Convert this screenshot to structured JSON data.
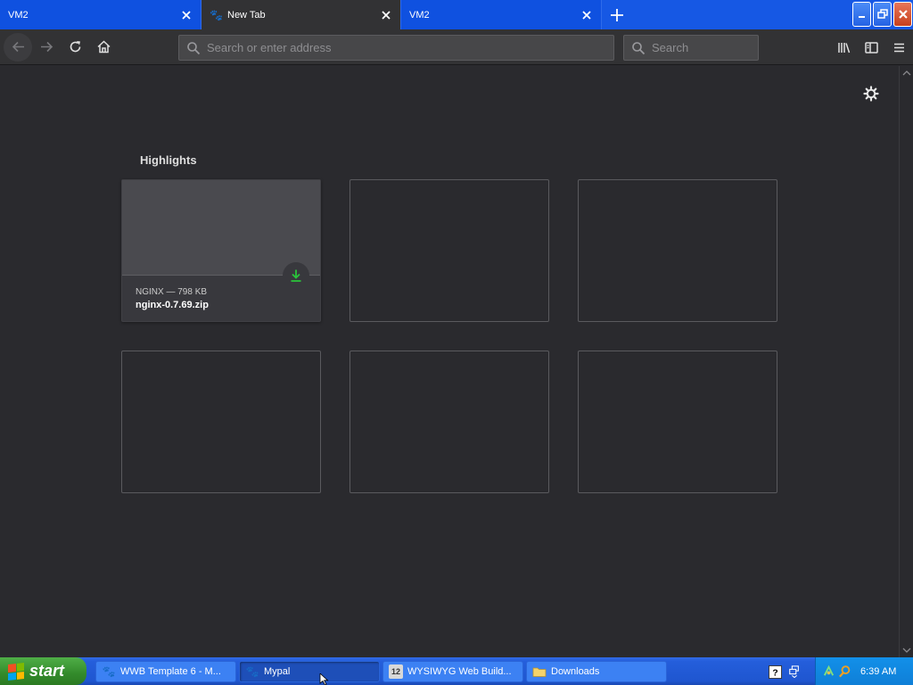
{
  "tabs": [
    {
      "label": "VM2",
      "active": false,
      "has_favicon": false,
      "favicon": ""
    },
    {
      "label": "New Tab",
      "active": true,
      "has_favicon": true,
      "favicon": "mypal-icon"
    },
    {
      "label": "VM2",
      "active": false,
      "has_favicon": false,
      "favicon": ""
    }
  ],
  "navbar": {
    "url_placeholder": "Search or enter address",
    "search_placeholder": "Search"
  },
  "content": {
    "highlights_title": "Highlights",
    "cards": [
      {
        "meta": "NGINX — 798 KB",
        "title": "nginx-0.7.69.zip",
        "type": "download"
      }
    ]
  },
  "taskbar": {
    "start_label": "start",
    "buttons": [
      {
        "label": "WWB Template 6 - M...",
        "icon": "app-icon",
        "active": false
      },
      {
        "label": "Mypal",
        "icon": "mypal-icon",
        "active": true
      },
      {
        "label": "WYSIWYG Web Build...",
        "icon": "wysiwyg-icon",
        "active": false
      },
      {
        "label": "Downloads",
        "icon": "folder-icon",
        "active": false
      }
    ],
    "clock": "6:39 AM"
  },
  "colors": {
    "tabstrip": "#1658e4",
    "toolbar": "#323234",
    "content_bg": "#2a2a2e",
    "download_green": "#2ac33a"
  }
}
